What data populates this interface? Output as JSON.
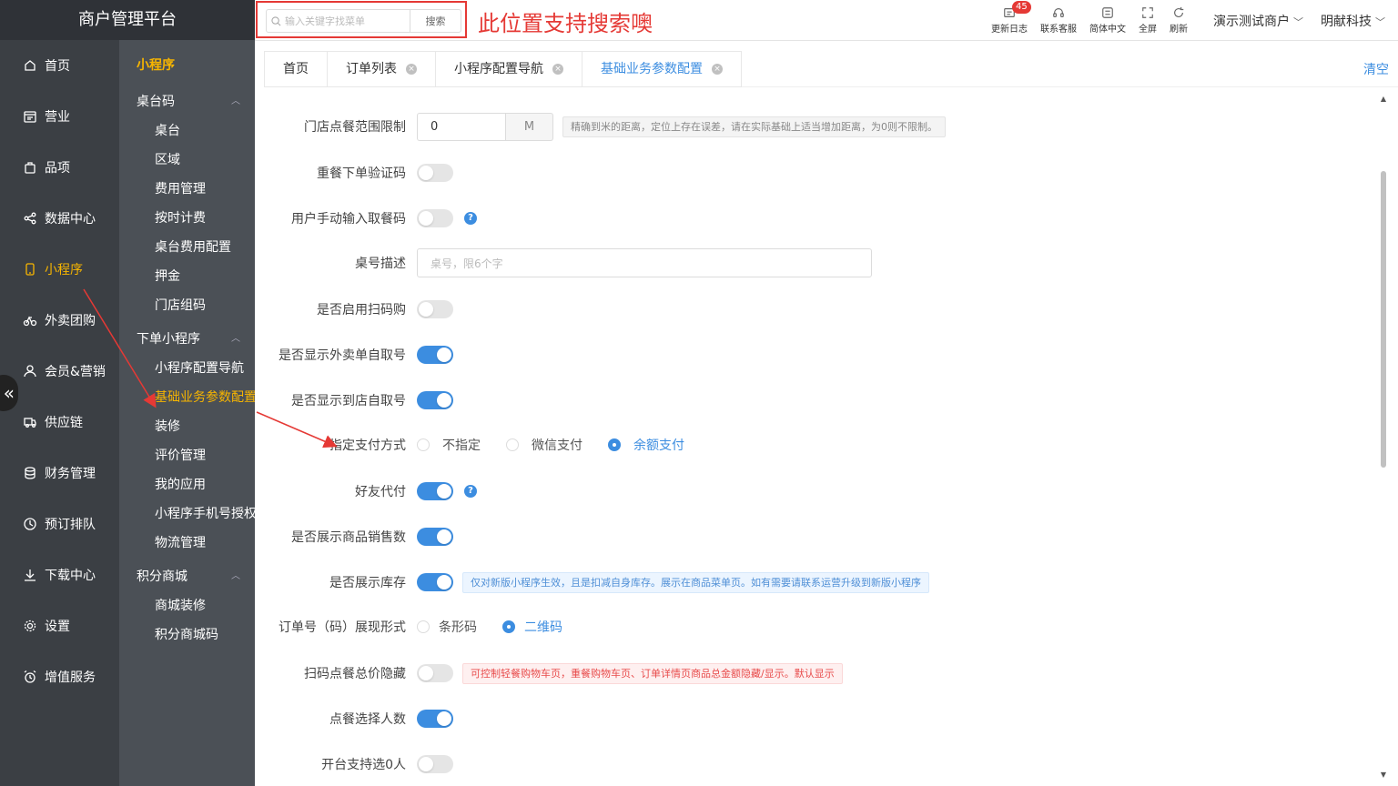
{
  "brand": "商户管理平台",
  "search": {
    "placeholder": "输入关键字找菜单",
    "button": "搜索"
  },
  "annotation": "此位置支持搜索噢",
  "tools": [
    {
      "label": "更新日志",
      "icon": "changelog-icon",
      "badge": "45"
    },
    {
      "label": "联系客服",
      "icon": "headset-icon"
    },
    {
      "label": "简体中文",
      "icon": "language-icon"
    },
    {
      "label": "全屏",
      "icon": "fullscreen-icon"
    },
    {
      "label": "刷新",
      "icon": "refresh-icon"
    }
  ],
  "account": {
    "merchant": "演示测试商户",
    "company": "明献科技"
  },
  "primary_nav": [
    {
      "label": "首页",
      "icon": "home-icon"
    },
    {
      "label": "营业",
      "icon": "calendar-icon"
    },
    {
      "label": "品项",
      "icon": "bag-icon"
    },
    {
      "label": "数据中心",
      "icon": "share-icon"
    },
    {
      "label": "小程序",
      "icon": "phone-icon",
      "active": true
    },
    {
      "label": "外卖团购",
      "icon": "bike-icon"
    },
    {
      "label": "会员&营销",
      "icon": "user-icon"
    },
    {
      "label": "供应链",
      "icon": "truck-icon"
    },
    {
      "label": "财务管理",
      "icon": "database-icon"
    },
    {
      "label": "预订排队",
      "icon": "clock-icon"
    },
    {
      "label": "下载中心",
      "icon": "download-icon"
    },
    {
      "label": "设置",
      "icon": "gear-icon"
    },
    {
      "label": "增值服务",
      "icon": "alarm-icon"
    }
  ],
  "secondary_nav": {
    "title": "小程序",
    "groups": [
      {
        "label": "桌台码",
        "items": [
          "桌台",
          "区域",
          "费用管理",
          "按时计费",
          "桌台费用配置",
          "押金",
          "门店组码"
        ]
      },
      {
        "label": "下单小程序",
        "items": [
          "小程序配置导航",
          "基础业务参数配置",
          "装修",
          "评价管理",
          "我的应用",
          "小程序手机号授权",
          "物流管理"
        ]
      },
      {
        "label": "积分商城",
        "items": [
          "商城装修",
          "积分商城码"
        ]
      }
    ],
    "active_item": "基础业务参数配置"
  },
  "tabs": [
    {
      "label": "首页",
      "closable": false
    },
    {
      "label": "订单列表",
      "closable": true
    },
    {
      "label": "小程序配置导航",
      "closable": true
    },
    {
      "label": "基础业务参数配置",
      "closable": true,
      "active": true
    }
  ],
  "clear_label": "清空",
  "form": {
    "range_limit": {
      "label": "门店点餐范围限制",
      "value": "0",
      "unit": "M",
      "tip": "精确到米的距离，定位上存在误差，请在实际基础上适当增加距离，为0则不限制。"
    },
    "reorder_code": {
      "label": "重餐下单验证码",
      "on": false
    },
    "manual_pickup": {
      "label": "用户手动输入取餐码",
      "on": false
    },
    "table_desc": {
      "label": "桌号描述",
      "placeholder": "桌号，限6个字"
    },
    "scan_buy": {
      "label": "是否启用扫码购",
      "on": false
    },
    "takeout_pickup": {
      "label": "是否显示外卖单自取号",
      "on": true
    },
    "store_pickup": {
      "label": "是否显示到店自取号",
      "on": true
    },
    "pay_method": {
      "label": "指定支付方式",
      "options": [
        "不指定",
        "微信支付",
        "余额支付"
      ],
      "selected": "余额支付"
    },
    "friend_pay": {
      "label": "好友代付",
      "on": true
    },
    "show_sales": {
      "label": "是否展示商品销售数",
      "on": true
    },
    "show_stock": {
      "label": "是否展示库存",
      "on": true,
      "tip": "仅对新版小程序生效，且是扣减自身库存。展示在商品菜单页。如有需要请联系运营升级到新版小程序"
    },
    "order_code_form": {
      "label": "订单号（码）展现形式",
      "options": [
        "条形码",
        "二维码"
      ],
      "selected": "二维码"
    },
    "hide_total": {
      "label": "扫码点餐总价隐藏",
      "on": false,
      "tip": "可控制轻餐购物车页，重餐购物车页、订单详情页商品总金额隐藏/显示。默认显示"
    },
    "select_people": {
      "label": "点餐选择人数",
      "on": true
    },
    "zero_people": {
      "label": "开台支持选0人",
      "on": false
    }
  },
  "colors": {
    "accent": "#3c8de0",
    "active_nav": "#f7b500",
    "annotation": "#e53935",
    "sidebar": "#3b3f44"
  }
}
